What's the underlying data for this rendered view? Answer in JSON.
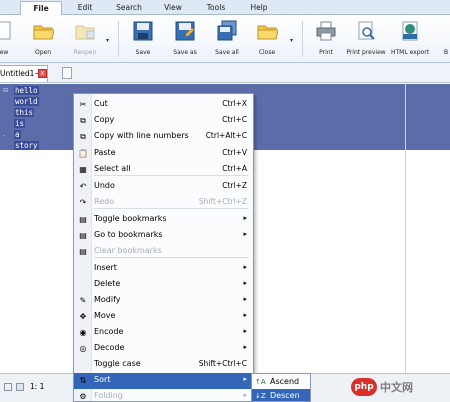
{
  "ribbon_tabs": [
    "File",
    "Edit",
    "Search",
    "View",
    "Tools",
    "Help"
  ],
  "ribbon": {
    "buttons": [
      {
        "label": "ew",
        "icon": "new-doc-icon"
      },
      {
        "label": "Open",
        "icon": "open-folder-icon"
      },
      {
        "label": "Reopen",
        "icon": "reopen-folder-icon"
      },
      {
        "label": "Save",
        "icon": "save-icon"
      },
      {
        "label": "Save as",
        "icon": "save-as-icon"
      },
      {
        "label": "Save all",
        "icon": "save-all-icon"
      },
      {
        "label": "Close",
        "icon": "close-folder-icon"
      },
      {
        "label": "Print",
        "icon": "printer-icon"
      },
      {
        "label": "Print preview",
        "icon": "print-preview-icon"
      },
      {
        "label": "HTML export",
        "icon": "html-export-icon"
      }
    ],
    "dropdown_arrow": "▾",
    "edge_label": "B"
  },
  "document": {
    "tab_label": "Untitled1~",
    "close_glyph": "x",
    "lines": [
      "hello",
      "world",
      "this",
      "is",
      "a",
      "story"
    ],
    "gutter_marks": [
      "⊟",
      "-"
    ]
  },
  "status": {
    "position": "1: 1"
  },
  "context_menu": {
    "items": [
      {
        "label": "Cut",
        "shortcut": "Ctrl+X",
        "icon": "✂",
        "enabled": true,
        "submenu": false
      },
      {
        "label": "Copy",
        "shortcut": "Ctrl+C",
        "icon": "⧉",
        "enabled": true,
        "submenu": false
      },
      {
        "label": "Copy with line numbers",
        "shortcut": "Ctrl+Alt+C",
        "icon": "⧉",
        "enabled": true,
        "submenu": false
      },
      {
        "label": "Paste",
        "shortcut": "Ctrl+V",
        "icon": "📋",
        "enabled": true,
        "submenu": false
      },
      {
        "label": "Select all",
        "shortcut": "Ctrl+A",
        "icon": "▦",
        "enabled": true,
        "submenu": false
      },
      {
        "label": "Undo",
        "shortcut": "Ctrl+Z",
        "icon": "↶",
        "enabled": true,
        "submenu": false
      },
      {
        "label": "Redo",
        "shortcut": "Shift+Ctrl+Z",
        "icon": "↷",
        "enabled": false,
        "submenu": false
      },
      {
        "label": "Toggle bookmarks",
        "shortcut": "",
        "icon": "▤",
        "enabled": true,
        "submenu": true
      },
      {
        "label": "Go to bookmarks",
        "shortcut": "",
        "icon": "▤",
        "enabled": true,
        "submenu": true
      },
      {
        "label": "Clear bookmarks",
        "shortcut": "",
        "icon": "▤",
        "enabled": false,
        "submenu": false
      },
      {
        "label": "Insert",
        "shortcut": "",
        "icon": "",
        "enabled": true,
        "submenu": true
      },
      {
        "label": "Delete",
        "shortcut": "",
        "icon": "",
        "enabled": true,
        "submenu": true
      },
      {
        "label": "Modify",
        "shortcut": "",
        "icon": "✎",
        "enabled": true,
        "submenu": true
      },
      {
        "label": "Move",
        "shortcut": "",
        "icon": "✥",
        "enabled": true,
        "submenu": true
      },
      {
        "label": "Encode",
        "shortcut": "",
        "icon": "◉",
        "enabled": true,
        "submenu": true
      },
      {
        "label": "Decode",
        "shortcut": "",
        "icon": "◎",
        "enabled": true,
        "submenu": true
      },
      {
        "label": "Toggle case",
        "shortcut": "Shift+Ctrl+C",
        "icon": "",
        "enabled": true,
        "submenu": false
      },
      {
        "label": "Sort",
        "shortcut": "",
        "icon": "⇅",
        "enabled": true,
        "submenu": true,
        "highlighted": true
      },
      {
        "label": "Folding",
        "shortcut": "",
        "icon": "⚙",
        "enabled": false,
        "submenu": true
      }
    ],
    "arrow": "▸"
  },
  "sort_submenu": {
    "items": [
      {
        "label": "Ascend",
        "icon": "↑A",
        "highlighted": false
      },
      {
        "label": "Descen",
        "icon": "↓Z",
        "highlighted": true
      }
    ]
  },
  "watermark": {
    "logo": "php",
    "text": "中文网"
  },
  "colors": {
    "selection": "#5b6ca8",
    "highlight": "#3366b8",
    "ribbon_bg": "#dfe8f5"
  }
}
